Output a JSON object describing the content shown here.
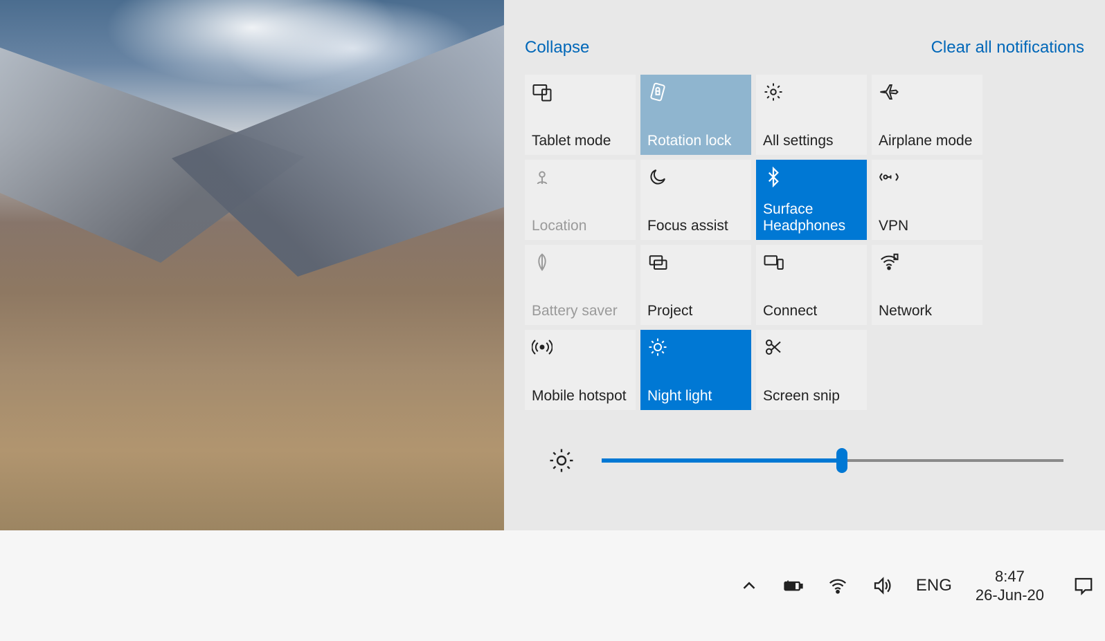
{
  "action_center": {
    "collapse_label": "Collapse",
    "clear_label": "Clear all notifications",
    "tiles": [
      {
        "id": "tablet-mode",
        "label": "Tablet mode",
        "state": "off",
        "icon": "tablet-mode-icon"
      },
      {
        "id": "rotation-lock",
        "label": "Rotation lock",
        "state": "on-mid",
        "icon": "rotation-lock-icon"
      },
      {
        "id": "all-settings",
        "label": "All settings",
        "state": "off",
        "icon": "gear-icon"
      },
      {
        "id": "airplane-mode",
        "label": "Airplane mode",
        "state": "off",
        "icon": "airplane-icon"
      },
      {
        "id": "location",
        "label": "Location",
        "state": "disabled",
        "icon": "location-icon"
      },
      {
        "id": "focus-assist",
        "label": "Focus assist",
        "state": "off",
        "icon": "moon-icon"
      },
      {
        "id": "bluetooth",
        "label": "Surface Headphones",
        "state": "on",
        "icon": "bluetooth-icon"
      },
      {
        "id": "vpn",
        "label": "VPN",
        "state": "off",
        "icon": "vpn-icon"
      },
      {
        "id": "battery-saver",
        "label": "Battery saver",
        "state": "disabled",
        "icon": "leaf-icon"
      },
      {
        "id": "project",
        "label": "Project",
        "state": "off",
        "icon": "project-icon"
      },
      {
        "id": "connect",
        "label": "Connect",
        "state": "off",
        "icon": "connect-icon"
      },
      {
        "id": "network",
        "label": "Network",
        "state": "off",
        "icon": "wifi-icon"
      },
      {
        "id": "mobile-hotspot",
        "label": "Mobile hotspot",
        "state": "off",
        "icon": "hotspot-icon"
      },
      {
        "id": "night-light",
        "label": "Night light",
        "state": "on",
        "icon": "night-light-icon"
      },
      {
        "id": "screen-snip",
        "label": "Screen snip",
        "state": "off",
        "icon": "scissors-icon"
      }
    ],
    "brightness_percent": 52
  },
  "taskbar": {
    "language": "ENG",
    "time": "8:47",
    "date": "26-Jun-20"
  },
  "colors": {
    "accent": "#0078d4",
    "accent_mid": "#8fb5cf",
    "tile_bg": "#eeeeee",
    "panel_bg": "#e8e8e8"
  }
}
